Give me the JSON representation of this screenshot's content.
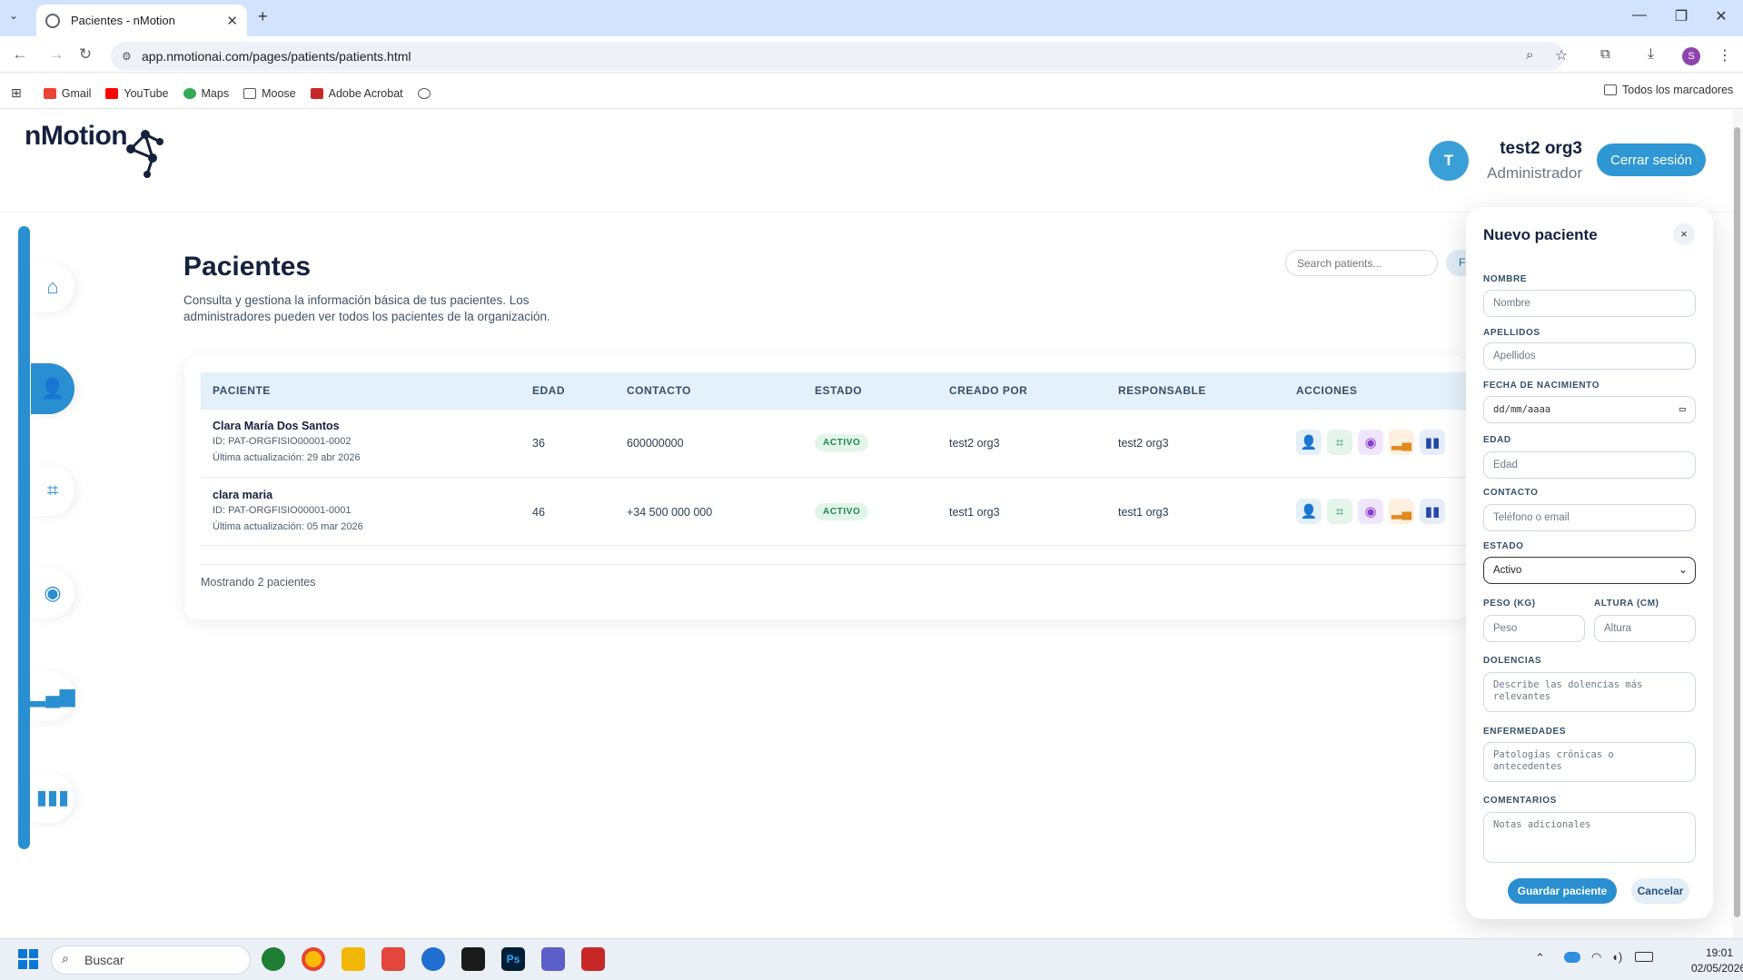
{
  "browser": {
    "tab_title": "Pacientes - nMotion",
    "url": "app.nmotionai.com/pages/patients/patients.html",
    "profile_initial": "S",
    "bookmarks": [
      "Gmail",
      "YouTube",
      "Maps",
      "Moose",
      "Adobe Acrobat"
    ],
    "all_bookmarks": "Todos los marcadores"
  },
  "app": {
    "logo": "nMotion",
    "user": {
      "initial": "T",
      "name": "test2 org3",
      "role": "Administrador"
    },
    "logout": "Cerrar sesión",
    "sidebar": [
      "home-icon",
      "patients-icon",
      "body-scan-icon",
      "eye-icon",
      "signal-chart-icon",
      "bar-chart-icon"
    ]
  },
  "page": {
    "title": "Pacientes",
    "subtitle": "Consulta y gestiona la información básica de tus pacientes. Los administradores pueden ver todos los pacientes de la organización.",
    "search_placeholder": "Search patients...",
    "filter_label": "F",
    "columns": [
      "PACIENTE",
      "EDAD",
      "CONTACTO",
      "ESTADO",
      "CREADO POR",
      "RESPONSABLE",
      "ACCIONES"
    ],
    "rows": [
      {
        "name": "Clara María Dos Santos",
        "id": "ID: PAT-ORGFISIO00001-0002",
        "updated": "Última actualización: 29 abr 2026",
        "age": "36",
        "contact": "600000000",
        "status": "ACTIVO",
        "created_by": "test2 org3",
        "responsible": "test2 org3"
      },
      {
        "name": "clara maria",
        "id": "ID: PAT-ORGFISIO00001-0001",
        "updated": "Última actualización: 05 mar 2026",
        "age": "46",
        "contact": "+34 500 000 000",
        "status": "ACTIVO",
        "created_by": "test1 org3",
        "responsible": "test1 org3"
      }
    ],
    "footer": "Mostrando 2 pacientes"
  },
  "panel": {
    "title": "Nuevo paciente",
    "close": "×",
    "fields": {
      "nombre": {
        "label": "NOMBRE",
        "placeholder": "Nombre"
      },
      "apellidos": {
        "label": "APELLIDOS",
        "placeholder": "Apellidos"
      },
      "fecha": {
        "label": "FECHA DE NACIMIENTO",
        "placeholder": "dd/mm/aaaa"
      },
      "edad": {
        "label": "EDAD",
        "placeholder": "Edad"
      },
      "contacto": {
        "label": "CONTACTO",
        "placeholder": "Teléfono o email"
      },
      "estado": {
        "label": "ESTADO",
        "value": "Activo"
      },
      "peso": {
        "label": "PESO (KG)",
        "placeholder": "Peso"
      },
      "altura": {
        "label": "ALTURA (CM)",
        "placeholder": "Altura"
      },
      "dolencias": {
        "label": "DOLENCIAS",
        "placeholder": "Describe las dolencias más relevantes"
      },
      "enfermedades": {
        "label": "ENFERMEDADES",
        "placeholder": "Patologías crónicas o antecedentes"
      },
      "comentarios": {
        "label": "COMENTARIOS",
        "placeholder": "Notas adicionales"
      }
    },
    "save": "Guardar paciente",
    "cancel": "Cancelar"
  },
  "taskbar": {
    "search": "Buscar",
    "time": "19:01",
    "date": "02/05/2026"
  }
}
